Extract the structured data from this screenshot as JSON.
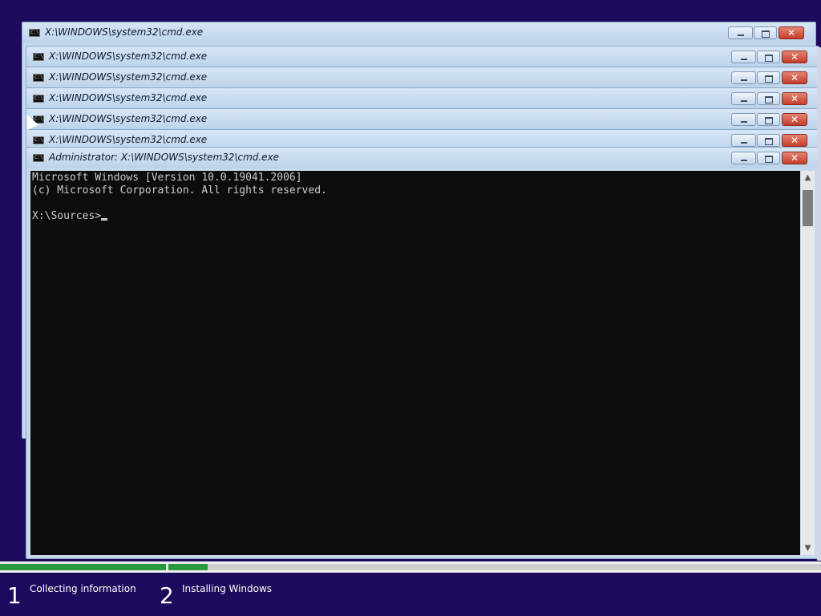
{
  "windows": [
    {
      "title": "X:\\WINDOWS\\system32\\cmd.exe"
    },
    {
      "title": "X:\\WINDOWS\\system32\\cmd.exe"
    },
    {
      "title": "X:\\WINDOWS\\system32\\cmd.exe"
    },
    {
      "title": "X:\\WINDOWS\\system32\\cmd.exe"
    },
    {
      "title": "X:\\WINDOWS\\system32\\cmd.exe"
    },
    {
      "title": "X:\\WINDOWS\\system32\\cmd.exe"
    }
  ],
  "main_window": {
    "title": "Administrator: X:\\WINDOWS\\system32\\cmd.exe",
    "console_lines": [
      "Microsoft Windows [Version 10.0.19041.2006]",
      "(c) Microsoft Corporation. All rights reserved.",
      "",
      "X:\\Sources>"
    ]
  },
  "controls": {
    "close_glyph": "✕"
  },
  "icons": {
    "cmd": "cmd-icon",
    "minimize": "minimize-icon",
    "maximize": "maximize-icon",
    "close": "close-icon"
  },
  "setup": {
    "steps": [
      {
        "number": "1",
        "label": "Collecting information",
        "progress": 1.0
      },
      {
        "number": "2",
        "label": "Installing Windows",
        "progress": 0.06
      }
    ],
    "colors": {
      "progress_fill": "#2a9b3c",
      "background": "#1e0a5c"
    }
  }
}
